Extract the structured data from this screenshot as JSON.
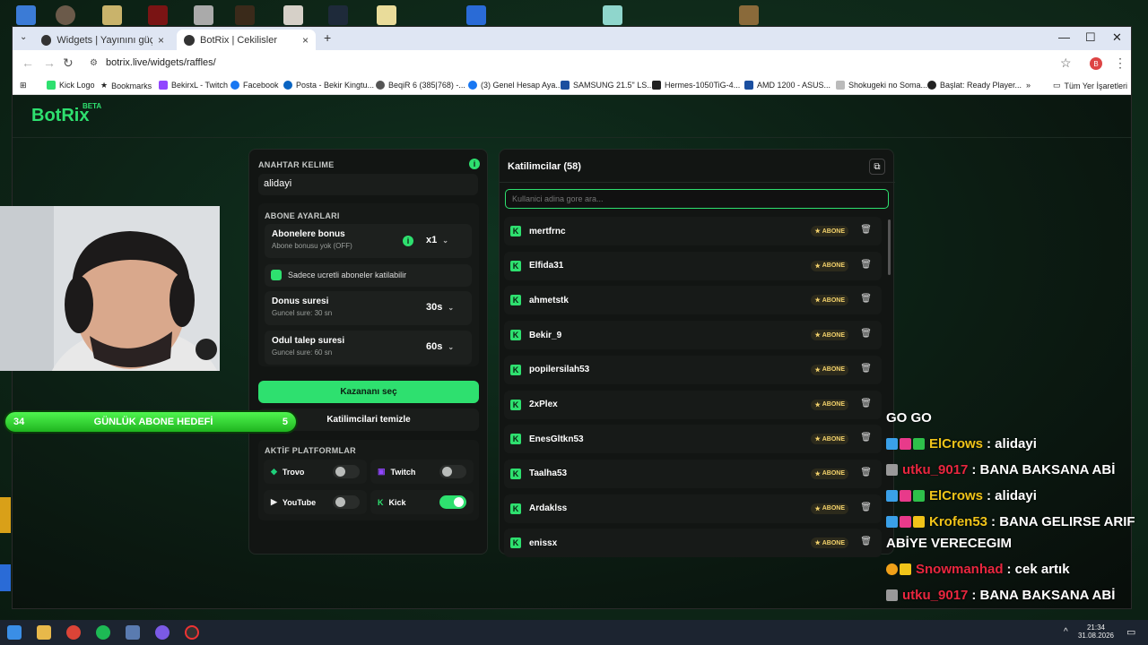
{
  "browser": {
    "tabs": [
      {
        "title": "Widgets | Yayınını güçlendirme",
        "active": false
      },
      {
        "title": "BotRix | Cekilisler",
        "active": true
      }
    ],
    "url": "botrix.live/widgets/raffles/",
    "profile_initial": "B",
    "bookmarks": [
      "Kick Logo",
      "Bookmarks",
      "BekirxL - Twitch",
      "Facebook",
      "Posta - Bekir Kingtu...",
      "BeqiR 6 (385|768) -...",
      "(3) Genel Hesap Aya...",
      "SAMSUNG 21.5\" LS...",
      "Hermes-1050TiG-4...",
      "AMD 1200 - ASUS...",
      "Shokugeki no Soma...",
      "Başlat: Ready Player..."
    ],
    "bookmarks_more": "»",
    "other_bookmarks": "Tüm Yer İşaretleri"
  },
  "app": {
    "logo": "BotRix",
    "beta": "BETA"
  },
  "settings": {
    "keyword_label": "ANAHTAR KELIME",
    "keyword_value": "alidayi",
    "sub_settings_label": "ABONE AYARLARI",
    "sub_bonus_title": "Abonelere bonus",
    "sub_bonus_sub": "Abone bonusu yok (OFF)",
    "sub_bonus_value": "x1",
    "paid_only_label": "Sadece ucretli aboneler katilabilir",
    "bonus_duration_title": "Donus suresi",
    "bonus_duration_sub": "Guncel sure: 30 sn",
    "bonus_duration_value": "30s",
    "claim_duration_title": "Odul talep suresi",
    "claim_duration_sub": "Guncel sure: 60 sn",
    "claim_duration_value": "60s",
    "pick_winner": "Kazananı seç",
    "clear_participants": "Katilimcilari temizle",
    "platforms_label": "AKTİF PLATFORMLAR",
    "platforms": [
      {
        "name": "Trovo",
        "on": false,
        "color": "#1fcf7a"
      },
      {
        "name": "Twitch",
        "on": false,
        "color": "#9146ff"
      },
      {
        "name": "YouTube",
        "on": false,
        "color": "#eeeeee"
      },
      {
        "name": "Kick",
        "on": true,
        "color": "#2ee06f"
      }
    ]
  },
  "participants": {
    "title": "Katilimcilar (58)",
    "search_placeholder": "Kullanici adina gore ara...",
    "badge_label": "ABONE",
    "items": [
      "mertfrnc",
      "Elfida31",
      "ahmetstk",
      "Bekir_9",
      "popilersilah53",
      "2xPlex",
      "EnesGltkn53",
      "Taalha53",
      "Ardaklss",
      "enissx"
    ]
  },
  "overlay": {
    "goal_left": "34",
    "goal_title": "GÜNLÜK ABONE HEDEFİ",
    "goal_right": "5",
    "chat": [
      {
        "user": "",
        "text": "GO GO",
        "user_color": "#ffffff"
      },
      {
        "user": "ElCrows",
        "text": ": alidayi",
        "user_color": "#f0c419"
      },
      {
        "user": "utku_9017",
        "text": ": BANA BAKSANA ABİ",
        "user_color": "#e8273f"
      },
      {
        "user": "ElCrows",
        "text": ": alidayi",
        "user_color": "#f0c419"
      },
      {
        "user": "Krofen53",
        "text": ": BANA GELIRSE ARIF",
        "user_color": "#f0c419"
      },
      {
        "user": "",
        "text": "ABİYE VERECEGIM",
        "user_color": "#ffffff"
      },
      {
        "user": "Snowmanhad",
        "text": ": cek artık",
        "user_color": "#e8273f"
      },
      {
        "user": "utku_9017",
        "text": ": BANA BAKSANA ABİ",
        "user_color": "#e8273f"
      }
    ]
  },
  "taskbar": {
    "time": "21:34",
    "date": "31.08.2026"
  }
}
